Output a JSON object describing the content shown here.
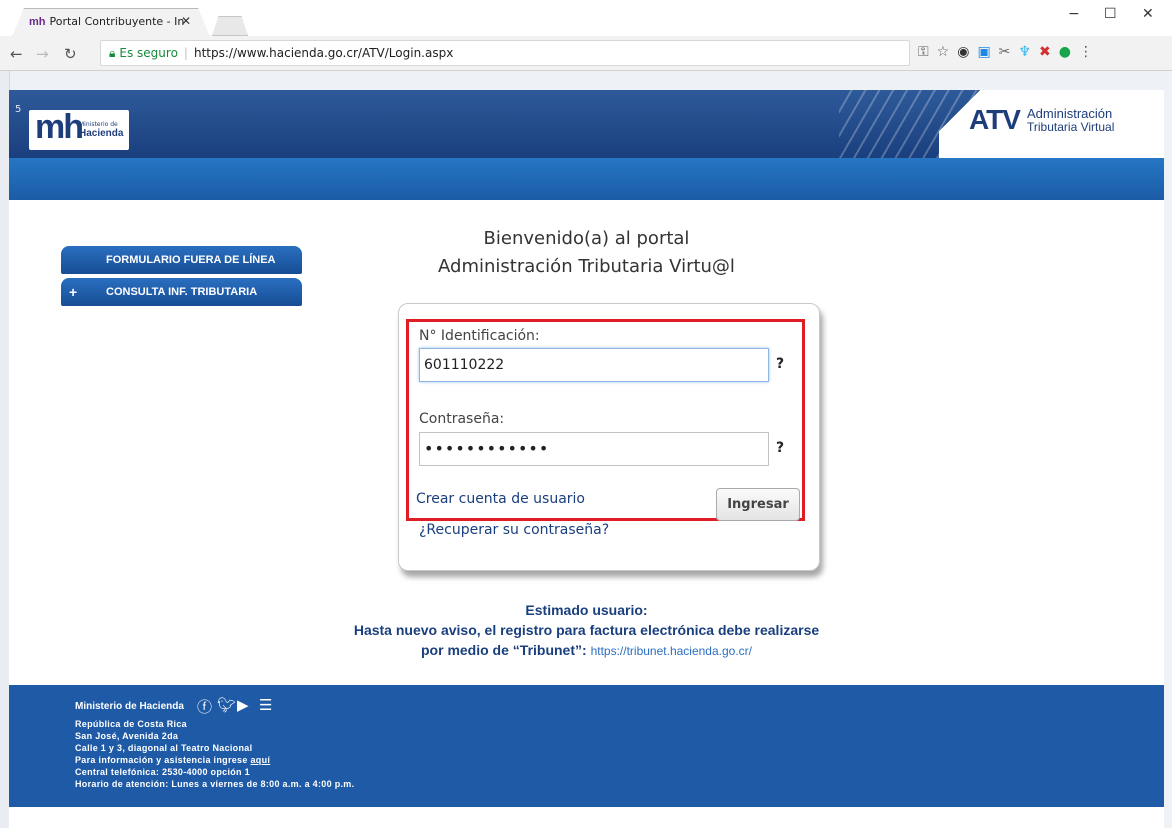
{
  "browser": {
    "tab_title": "Portal Contribuyente - In",
    "tab_favicon": "mh",
    "tab_close": "✕",
    "secure_label": "Es seguro",
    "url": "https://www.hacienda.go.cr/ATV/Login.aspx"
  },
  "header": {
    "corner_mark": "5",
    "logo_mark": "mh",
    "logo_ministerio": "Ministerio de",
    "logo_hacienda": "Hacienda",
    "atv_logo": "ATV",
    "atv_line1": "Administración",
    "atv_line2": "Tributaria Virtual"
  },
  "sidebar": {
    "items": [
      {
        "label": "FORMULARIO FUERA DE LÍNEA"
      },
      {
        "label": "CONSULTA INF. TRIBUTARIA",
        "prefix": "+"
      }
    ]
  },
  "welcome": {
    "line1": "Bienvenido(a) al portal",
    "line2": "Administración Tributaria Virtu@l"
  },
  "login": {
    "id_label": "N° Identificación:",
    "id_value": "601110222",
    "password_label": "Contraseña:",
    "password_value": "••••••••••••",
    "help": "?",
    "create_account": "Crear cuenta de usuario",
    "recover_password": "¿Recuperar su contraseña?",
    "submit": "Ingresar"
  },
  "notice": {
    "line1": "Estimado usuario:",
    "line2": "Hasta nuevo aviso, el registro para factura electrónica debe realizarse",
    "line3": "por medio de “Tribunet”:",
    "link": "https://tribunet.hacienda.go.cr/"
  },
  "footer": {
    "title": "Ministerio de Hacienda",
    "lines": [
      "República de Costa Rica",
      "San José, Avenida 2da",
      "Calle 1 y 3, diagonal al Teatro Nacional",
      "Para información y asistencia ingrese",
      "Central telefónica: 2530-4000 opción 1",
      "Horario de atención: Lunes a viernes de 8:00 a.m. a 4:00 p.m."
    ],
    "help_link": "aquí"
  }
}
